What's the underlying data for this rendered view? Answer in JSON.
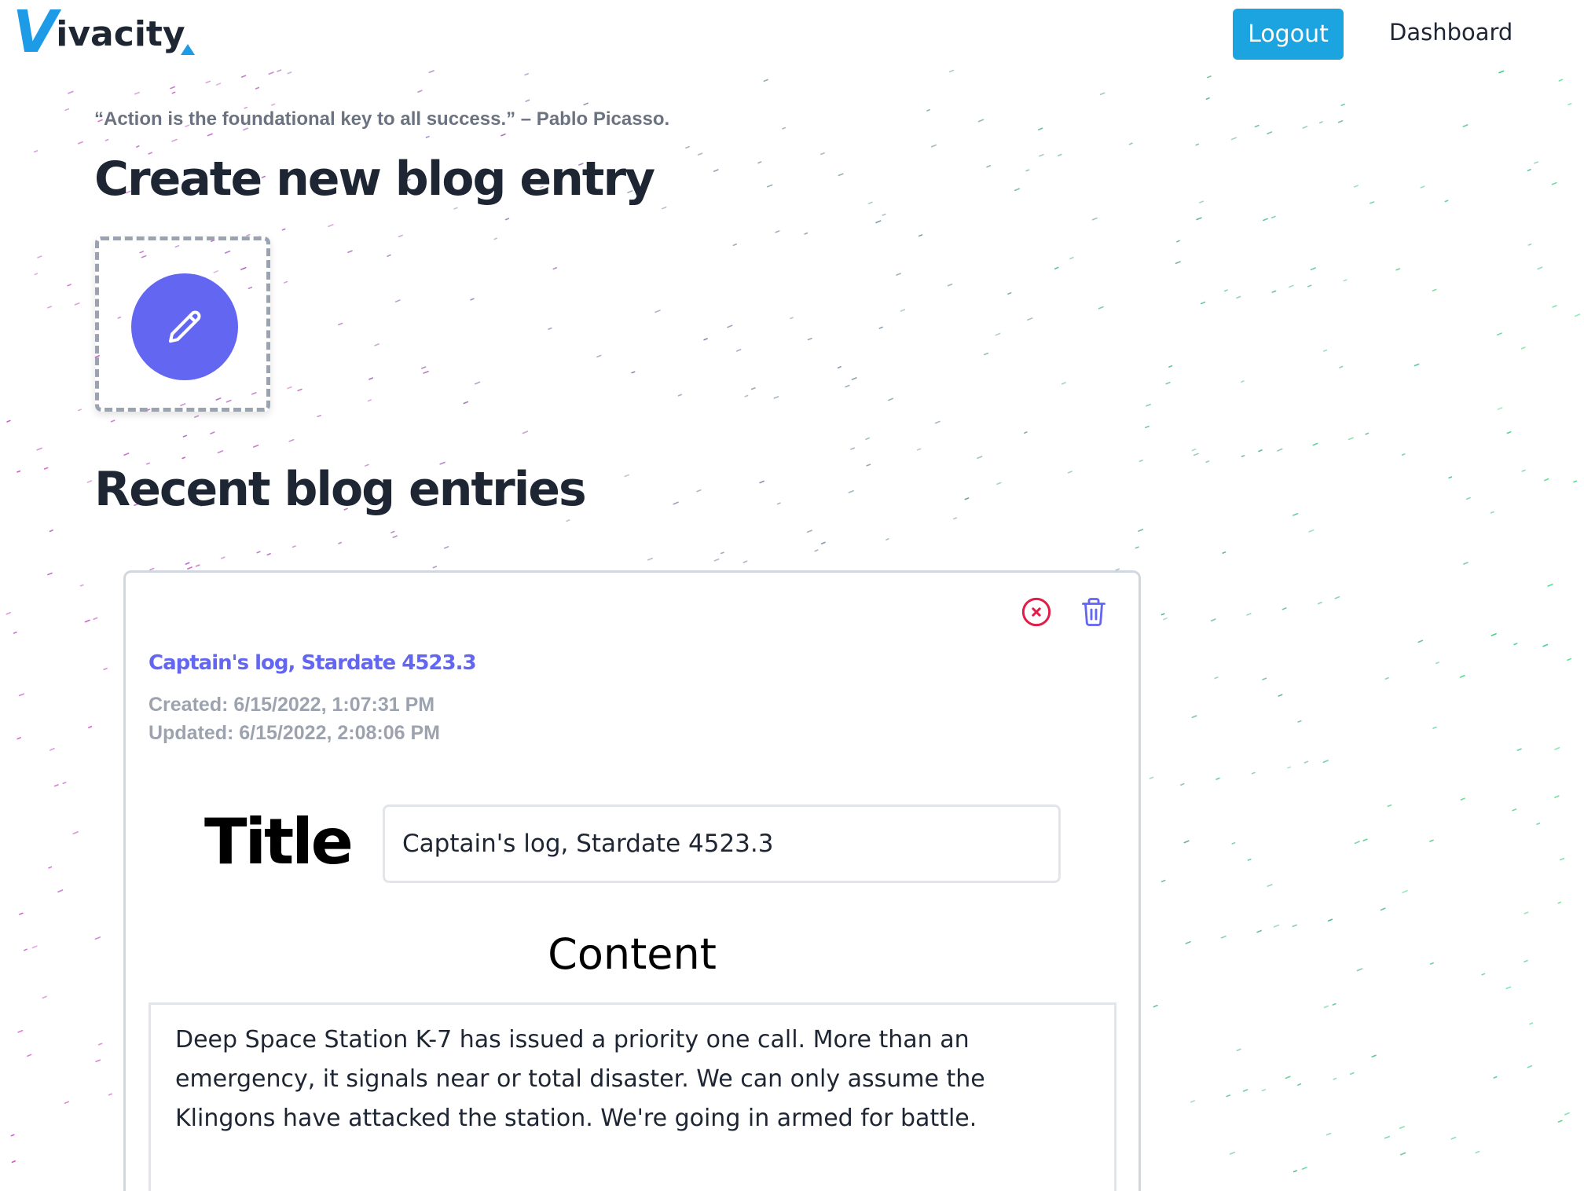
{
  "header": {
    "logo_initial": "V",
    "logo_rest": "ivacity",
    "logout_label": "Logout",
    "dashboard_label": "Dashboard"
  },
  "main": {
    "quote": "“Action is the foundational key to all success.” – Pablo Picasso.",
    "create_heading": "Create new blog entry",
    "recent_heading": "Recent blog entries"
  },
  "entry": {
    "title": "Captain's log, Stardate 4523.3",
    "created": "Created: 6/15/2022, 1:07:31 PM",
    "updated": "Updated: 6/15/2022, 2:08:06 PM",
    "title_label": "Title",
    "title_value": "Captain's log, Stardate 4523.3",
    "content_label": "Content",
    "content_value": "Deep Space Station K-7 has issued a priority one call. More than an emergency, it signals near or total disaster. We can only assume the Klingons have attacked the station. We're going in armed for battle."
  },
  "icons": {
    "create": "pencil-icon",
    "close": "close-circle-icon",
    "delete": "trash-icon"
  },
  "colors": {
    "brand": "#1d9be6",
    "logout_button": "#1ca4e0",
    "accent": "#6366f1",
    "close_icon": "#e11d48",
    "heading": "#1e2533",
    "muted": "#9ca3af"
  }
}
